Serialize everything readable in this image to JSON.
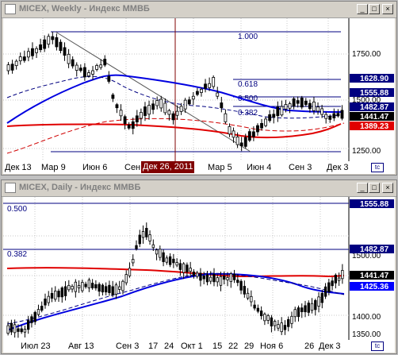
{
  "weekly": {
    "title": "MICEX, Weekly - Индекс ММВБ",
    "x_labels": [
      "Дек 13",
      "Мар 9",
      "Июн 6",
      "Сен 3",
      "Дек 26, 2011",
      "Мар 5",
      "Июн 4",
      "Сен 3",
      "Дек 3"
    ],
    "selected_x_label": "Дек 26, 2011",
    "price_labels": [
      "1750.00",
      "1500.00",
      "1250.00"
    ],
    "value_tags": [
      {
        "text": "1628.90",
        "color": "#000080"
      },
      {
        "text": "1555.88",
        "color": "#000080"
      },
      {
        "text": "1482.87",
        "color": "#000080"
      },
      {
        "text": "1441.47",
        "color": "#000000"
      },
      {
        "text": "1389.23",
        "color": "#e00000"
      }
    ],
    "fib_levels": [
      "1.000",
      "0.618",
      "0.500",
      "0.382"
    ]
  },
  "daily": {
    "title": "MICEX, Daily - Индекс ММВБ",
    "x_labels": [
      "Июл 23",
      "Авг 13",
      "Сен 3",
      "17",
      "24",
      "Окт 1",
      "15",
      "22",
      "29",
      "Ноя 6",
      "26",
      "Дек 3"
    ],
    "price_labels": [
      "1500.00",
      "1450.00",
      "1400.00",
      "1350.00"
    ],
    "value_tags": [
      {
        "text": "1555.88",
        "color": "#000080"
      },
      {
        "text": "1482.87",
        "color": "#000080"
      },
      {
        "text": "1441.47",
        "color": "#000000"
      },
      {
        "text": "1425.36",
        "color": "#0000ff"
      }
    ],
    "fib_levels": [
      "0.500",
      "0.382"
    ]
  },
  "window_buttons": {
    "minimize": "_",
    "maximize": "□",
    "close": "×"
  },
  "icons": {
    "window": "chart-window-icon",
    "corner": "chart-settings-icon"
  }
}
